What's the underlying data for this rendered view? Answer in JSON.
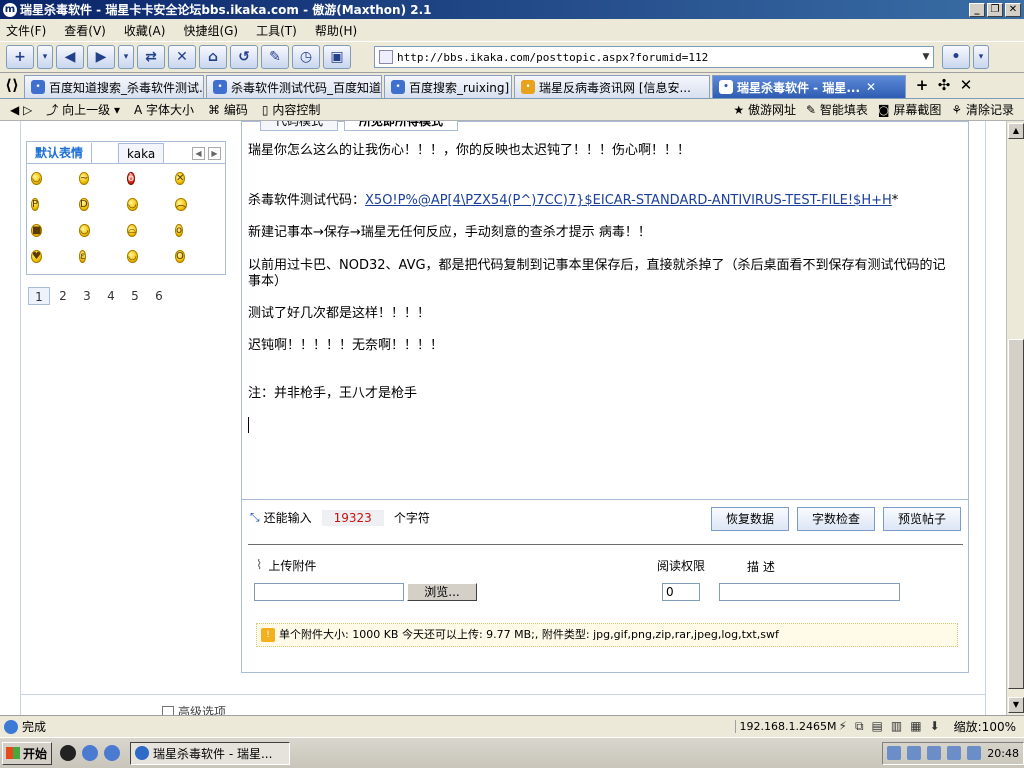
{
  "window": {
    "title": "瑞星杀毒软件 - 瑞星卡卡安全论坛bbs.ikaka.com - 傲游(Maxthon) 2.1"
  },
  "menu": [
    "文件(F)",
    "查看(V)",
    "收藏(A)",
    "快捷组(G)",
    "工具(T)",
    "帮助(H)"
  ],
  "address": {
    "url": "http://bbs.ikaka.com/posttopic.aspx?forumid=112"
  },
  "tabs": [
    {
      "label": "百度知道搜索_杀毒软件测试..."
    },
    {
      "label": "杀毒软件测试代码_百度知道"
    },
    {
      "label": "百度搜索_ruixing]"
    },
    {
      "label": "瑞星反病毒资讯网 [信息安..."
    },
    {
      "label": "瑞星杀毒软件 - 瑞星..."
    }
  ],
  "utilbar": {
    "up": "向上一级",
    "fontsize": "字体大小",
    "encoding": "编码",
    "content_control": "内容控制",
    "right": [
      "傲游网址",
      "智能填表",
      "屏幕截图",
      "清除记录"
    ]
  },
  "emoji": {
    "tab_default": "默认表情",
    "tab_kaka": "kaka",
    "faces": [
      "smile-icon",
      "worried-icon",
      "angry-icon",
      "banned-icon",
      "tongue-icon",
      "grin-icon",
      "smile2-icon",
      "sad-icon",
      "cool-icon",
      "laugh-icon",
      "upset-icon",
      "surprised-icon",
      "love-icon",
      "shy-icon",
      "wink-icon",
      "shock-icon"
    ]
  },
  "pager": [
    "1",
    "2",
    "3",
    "4",
    "5",
    "6"
  ],
  "editor": {
    "tab_code": "代码模式",
    "tab_wysiwyg": "所见即所得模式",
    "line1": "瑞星你怎么这么的让我伤心！！！，你的反映也太迟钝了！！！伤心啊！！！",
    "line2_prefix": "杀毒软件测试代码：",
    "line2_link": "X5O!P%@AP[4\\PZX54(P^)7CC)7}$EICAR-STANDARD-ANTIVIRUS-TEST-FILE!$H+H",
    "line2_suffix": "*",
    "line3": "新建记事本→保存→瑞星无任何反应，手动刻意的查杀才提示 病毒！！",
    "line4": "以前用过卡巴、NOD32、AVG，都是把代码复制到记事本里保存后，直接就杀掉了（杀后桌面看不到保存有测试代码的记事本）",
    "line5": "测试了好几次都是这样！！！！",
    "line6": "迟钝啊！！！！！无奈啊！！！！",
    "line7": "注：并非枪手，王八才是枪手"
  },
  "counter": {
    "prefix": "还能输入",
    "value": "19323",
    "suffix": "个字符"
  },
  "buttons": {
    "restore": "恢复数据",
    "count": "字数检查",
    "preview": "预览帖子"
  },
  "attachment": {
    "label": "上传附件",
    "browse": "浏览...",
    "perm_label": "阅读权限",
    "perm_value": "0",
    "desc_label": "描 述",
    "info": "单个附件大小: 1000 KB  今天还可以上传: 9.77 MB;,  附件类型: jpg,gif,png,zip,rar,jpeg,log,txt,swf"
  },
  "advanced": "高级选项",
  "status": {
    "done": "完成",
    "ip": "192.168.1.2465M",
    "zoom": "缩放:100%"
  },
  "taskbar": {
    "start": "开始",
    "task": "瑞星杀毒软件 - 瑞星...",
    "clock": "20:48"
  }
}
